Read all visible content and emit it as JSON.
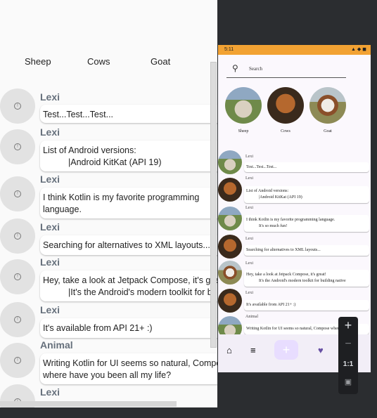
{
  "tabs": [
    "Sheep",
    "Cows",
    "Goat"
  ],
  "messages": [
    {
      "author": "Lexi",
      "line1": "Test...Test...Test...",
      "line2": ""
    },
    {
      "author": "Lexi",
      "line1": "List of Android versions:",
      "line2": "|Android KitKat (API 19)"
    },
    {
      "author": "Lexi",
      "line1": "I think Kotlin is my favorite programming",
      "line2": "language."
    },
    {
      "author": "Lexi",
      "line1": "Searching for alternatives to XML layouts...",
      "line2": ""
    },
    {
      "author": "Lexi",
      "line1": "Hey, take a look at Jetpack Compose, it's great!",
      "line2": "|It's the Android's modern toolkit for building native"
    },
    {
      "author": "Lexi",
      "line1": "It's available from API 21+ :)",
      "line2": ""
    },
    {
      "author": "Animal",
      "line1": "Writing Kotlin for UI seems so natural, Compose where have",
      "line2": "where have you been all my life?"
    },
    {
      "author": "Lexi",
      "line1": "",
      "line2": ""
    }
  ],
  "phone": {
    "time": "5:11",
    "status_icons": "▲ ◆ ◼",
    "search_placeholder": "Search",
    "categories": [
      "Sheep",
      "Cows",
      "Goat"
    ],
    "messages": [
      {
        "author": "Lexi",
        "line1": "Test...Test...Test...",
        "line2": ""
      },
      {
        "author": "Lexi",
        "line1": "List of Android versions:",
        "line2": "|Android KitKat (API 19)"
      },
      {
        "author": "Lexi",
        "line1": "I think Kotlin is my favorite programming language.",
        "line2": "It's so much fun!"
      },
      {
        "author": "Lexi",
        "line1": "Searching for alternatives to XML layouts...",
        "line2": ""
      },
      {
        "author": "Lexi",
        "line1": "Hey, take a look at Jetpack Compose, it's great!",
        "line2": "It's the Android's modern toolkit for building native"
      },
      {
        "author": "Lexi",
        "line1": "It's available from API 21+ :)",
        "line2": ""
      },
      {
        "author": "Animal",
        "line1": "Writing Kotlin for UI seems so natural, Compose where have",
        "line2": ""
      }
    ]
  },
  "zoom": {
    "plus": "+",
    "minus": "−",
    "ratio": "1:1"
  },
  "colors": {
    "status_bar": "#f2a233",
    "fab": "#e8ddff",
    "heart": "#6750a4"
  }
}
